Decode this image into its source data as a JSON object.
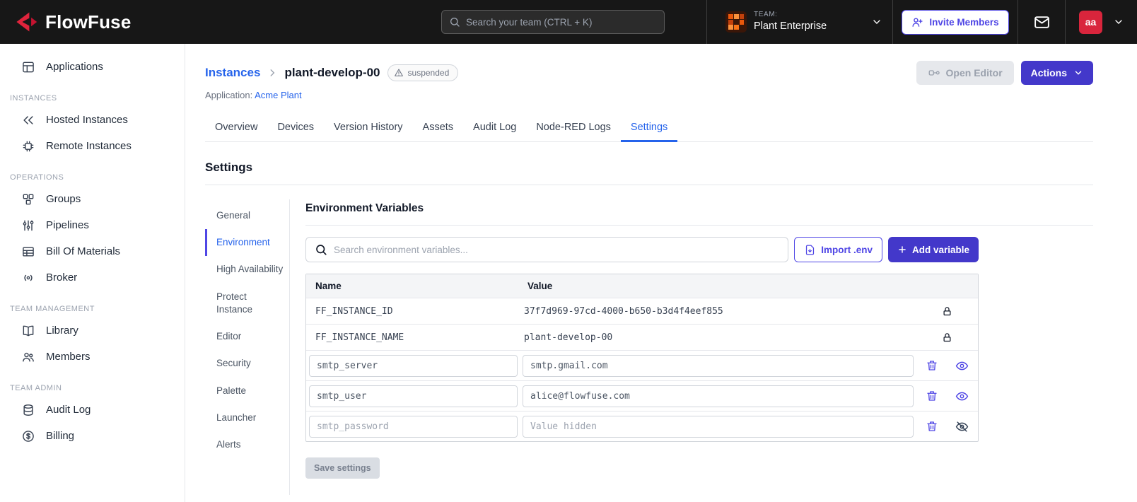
{
  "navbar": {
    "brand": "FlowFuse",
    "search_placeholder": "Search your team (CTRL + K)",
    "team_label": "TEAM:",
    "team_name": "Plant Enterprise",
    "invite_button": "Invite Members",
    "avatar_initials": "aa"
  },
  "sidebar": {
    "items": [
      "Applications",
      "Hosted Instances",
      "Remote Instances",
      "Groups",
      "Pipelines",
      "Bill Of Materials",
      "Broker",
      "Library",
      "Members",
      "Audit Log",
      "Billing"
    ],
    "section_labels": [
      "INSTANCES",
      "OPERATIONS",
      "TEAM MANAGEMENT",
      "TEAM ADMIN"
    ]
  },
  "header": {
    "breadcrumb_parent": "Instances",
    "breadcrumb_current": "plant-develop-00",
    "status_badge": "suspended",
    "application_label": "Application:",
    "application_name": "Acme Plant",
    "open_editor_button": "Open Editor",
    "actions_button": "Actions"
  },
  "tabs": [
    "Overview",
    "Devices",
    "Version History",
    "Assets",
    "Audit Log",
    "Node-RED Logs",
    "Settings"
  ],
  "active_tab": "Settings",
  "settings": {
    "title": "Settings",
    "nav": [
      "General",
      "Environment",
      "High Availability",
      "Protect Instance",
      "Editor",
      "Security",
      "Palette",
      "Launcher",
      "Alerts"
    ],
    "active_nav": "Environment",
    "env": {
      "title": "Environment Variables",
      "search_placeholder": "Search environment variables...",
      "import_button": "Import .env",
      "add_button": "Add variable",
      "save_button": "Save settings",
      "table": {
        "columns": [
          "Name",
          "Value"
        ],
        "locked_rows": [
          {
            "name": "FF_INSTANCE_ID",
            "value": "37f7d969-97cd-4000-b650-b3d4f4eef855"
          },
          {
            "name": "FF_INSTANCE_NAME",
            "value": "plant-develop-00"
          }
        ],
        "editable_rows": [
          {
            "name": "smtp_server",
            "value": "smtp.gmail.com",
            "hidden": false
          },
          {
            "name": "smtp_user",
            "value": "alice@flowfuse.com",
            "hidden": false
          },
          {
            "name": "smtp_password",
            "value": "",
            "value_placeholder": "Value hidden",
            "hidden": true
          }
        ]
      }
    }
  },
  "colors": {
    "accent_indigo": "#4338ca",
    "outline_indigo": "#4f46e5",
    "link_blue": "#2563eb",
    "brand_red": "#e0243c",
    "avatar_red": "#d9253c",
    "navbar_bg": "#171717"
  }
}
